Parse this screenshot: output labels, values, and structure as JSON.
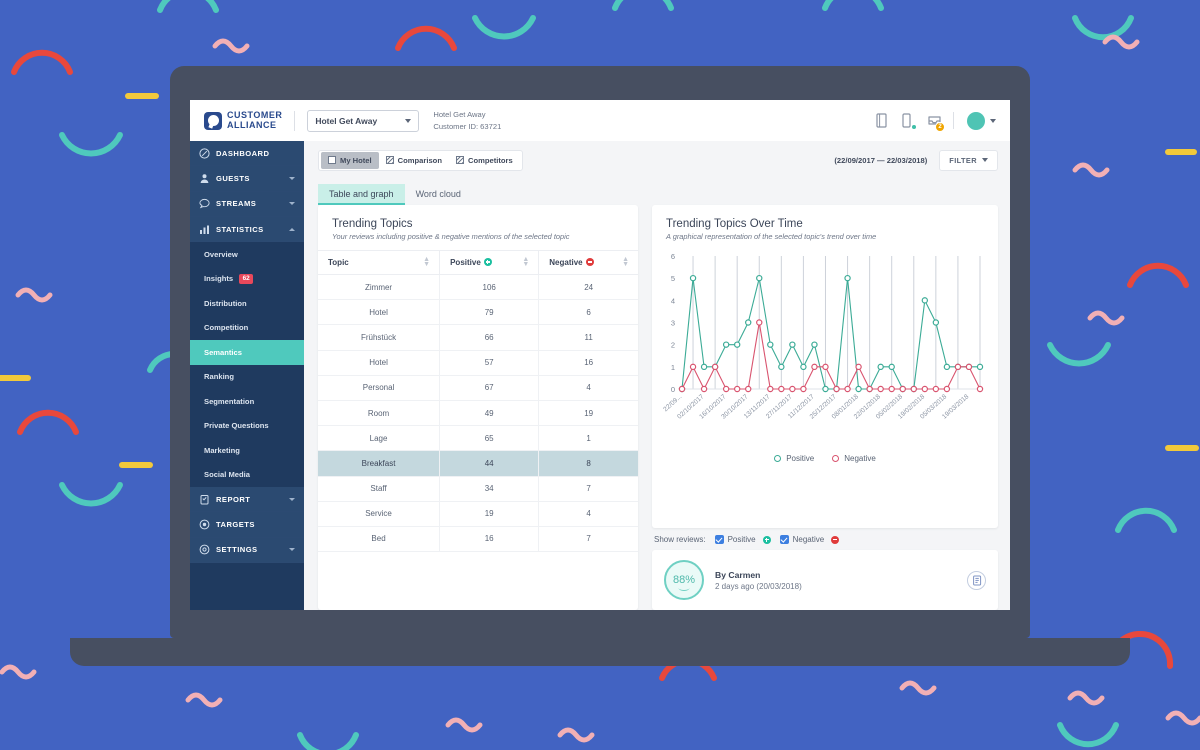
{
  "topbar": {
    "logo_line1": "CUSTOMER",
    "logo_line2": "ALLIANCE",
    "hotel_select_value": "Hotel Get Away",
    "hotel_name": "Hotel Get Away",
    "customer_id": "Customer ID: 63721",
    "icons": [
      "document-icon",
      "mobile-icon",
      "inbox-icon"
    ],
    "inbox_badge": "2"
  },
  "sidebar": {
    "items": [
      {
        "label": "DASHBOARD",
        "icon": "dashboard-icon",
        "arrow": "none"
      },
      {
        "label": "GUESTS",
        "icon": "guests-icon",
        "arrow": "down"
      },
      {
        "label": "STREAMS",
        "icon": "streams-icon",
        "arrow": "down"
      },
      {
        "label": "STATISTICS",
        "icon": "statistics-icon",
        "arrow": "up"
      }
    ],
    "statistics_sub": [
      {
        "label": "Overview",
        "badge": ""
      },
      {
        "label": "Insights",
        "badge": "62"
      },
      {
        "label": "Distribution",
        "badge": ""
      },
      {
        "label": "Competition",
        "badge": ""
      },
      {
        "label": "Semantics",
        "badge": "",
        "active": true
      },
      {
        "label": "Ranking",
        "badge": ""
      },
      {
        "label": "Segmentation",
        "badge": ""
      },
      {
        "label": "Private Questions",
        "badge": ""
      },
      {
        "label": "Marketing",
        "badge": ""
      },
      {
        "label": "Social Media",
        "badge": ""
      }
    ],
    "items_bottom": [
      {
        "label": "REPORT",
        "icon": "report-icon",
        "arrow": "down"
      },
      {
        "label": "TARGETS",
        "icon": "targets-icon",
        "arrow": "none"
      },
      {
        "label": "SETTINGS",
        "icon": "settings-icon",
        "arrow": "down"
      }
    ],
    "active_color": "#4fc9bd",
    "bg_color": "#1f3a5f"
  },
  "filterbar": {
    "segments": [
      {
        "label": "My Hotel",
        "active": true,
        "swatch": "plain"
      },
      {
        "label": "Comparison",
        "active": false,
        "swatch": "half-hatch"
      },
      {
        "label": "Competitors",
        "active": false,
        "swatch": "hatch"
      }
    ],
    "date_range": "(22/09/2017 — 22/03/2018)",
    "filter_label": "FILTER"
  },
  "tabs": [
    {
      "label": "Table and graph",
      "active": true
    },
    {
      "label": "Word cloud",
      "active": false
    }
  ],
  "left_panel": {
    "title": "Trending Topics",
    "subtitle": "Your reviews including positive & negative mentions of the selected topic",
    "columns": [
      "Topic",
      "Positive",
      "Negative"
    ],
    "rows": [
      {
        "topic": "Zimmer",
        "positive": "106",
        "negative": "24",
        "selected": false
      },
      {
        "topic": "Hotel",
        "positive": "79",
        "negative": "6",
        "selected": false
      },
      {
        "topic": "Frühstück",
        "positive": "66",
        "negative": "11",
        "selected": false
      },
      {
        "topic": "Hotel",
        "positive": "57",
        "negative": "16",
        "selected": false
      },
      {
        "topic": "Personal",
        "positive": "67",
        "negative": "4",
        "selected": false
      },
      {
        "topic": "Room",
        "positive": "49",
        "negative": "19",
        "selected": false
      },
      {
        "topic": "Lage",
        "positive": "65",
        "negative": "1",
        "selected": false
      },
      {
        "topic": "Breakfast",
        "positive": "44",
        "negative": "8",
        "selected": true
      },
      {
        "topic": "Staff",
        "positive": "34",
        "negative": "7",
        "selected": false
      },
      {
        "topic": "Service",
        "positive": "19",
        "negative": "4",
        "selected": false
      },
      {
        "topic": "Bed",
        "positive": "16",
        "negative": "7",
        "selected": false
      }
    ]
  },
  "right_panel": {
    "title": "Trending Topics Over Time",
    "subtitle": "A graphical representation of the selected topic's trend over time",
    "show_reviews_label": "Show reviews:",
    "checkbox_positive": "Positive",
    "checkbox_negative": "Negative"
  },
  "review": {
    "score": "88%",
    "author": "By Carmen",
    "date": "2 days ago (20/03/2018)"
  },
  "chart_data": {
    "type": "line",
    "title": "Trending Topics Over Time",
    "subtitle": "A graphical representation of the selected topic's trend over time",
    "xlabel": "",
    "ylabel": "",
    "ylim": [
      0,
      6
    ],
    "yticks": [
      0,
      1,
      2,
      3,
      4,
      5,
      6
    ],
    "grid": "vertical",
    "legend_position": "bottom",
    "tick_labels": [
      "22/09...",
      "02/10/2017",
      "16/10/2017",
      "30/10/2017",
      "13/11/2017",
      "27/11/2017",
      "11/12/2017",
      "25/12/2017",
      "08/01/2018",
      "22/01/2018",
      "05/02/2018",
      "19/02/2018",
      "05/03/2018",
      "19/03/2018"
    ],
    "x": [
      1,
      2,
      3,
      4,
      5,
      6,
      7,
      8,
      9,
      10,
      11,
      12,
      13,
      14,
      15,
      16,
      17,
      18,
      19,
      20,
      21,
      22,
      23,
      24,
      25,
      26,
      27,
      28
    ],
    "series": [
      {
        "name": "Positive",
        "color": "#3bab96",
        "values": [
          0,
          5,
          1,
          1,
          2,
          2,
          3,
          5,
          2,
          1,
          2,
          1,
          2,
          0,
          0,
          5,
          0,
          0,
          1,
          1,
          0,
          0,
          4,
          3,
          1,
          1,
          1,
          1
        ]
      },
      {
        "name": "Negative",
        "color": "#d9546f",
        "values": [
          0,
          1,
          0,
          1,
          0,
          0,
          0,
          3,
          0,
          0,
          0,
          0,
          1,
          1,
          0,
          0,
          1,
          0,
          0,
          0,
          0,
          0,
          0,
          0,
          0,
          1,
          1,
          0
        ]
      }
    ]
  }
}
